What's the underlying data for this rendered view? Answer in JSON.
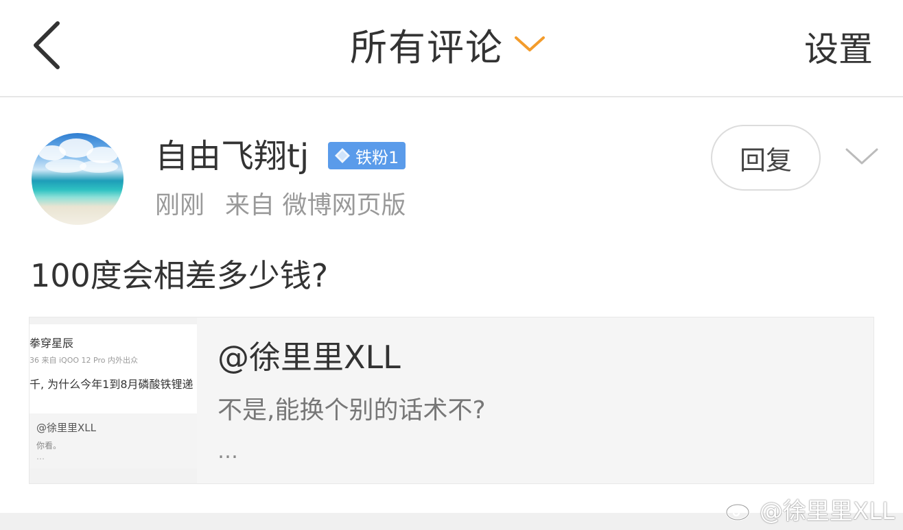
{
  "header": {
    "title": "所有评论",
    "settings_label": "设置"
  },
  "comment": {
    "username": "自由飞翔tj",
    "badge": "铁粉1",
    "time": "刚刚",
    "source": "来自 微博网页版",
    "reply_label": "回复",
    "text": "100度会相差多少钱?"
  },
  "quote": {
    "author": "@徐里里XLL",
    "text": "不是,能换个别的话术不?",
    "ellipsis": "…",
    "thumbnail": {
      "line1": "拳穿星辰",
      "line2": "36 来自 iQOO 12 Pro 内外出众",
      "line3": "千, 为什么今年1到8月磷酸铁锂递",
      "line4": "@徐里里XLL",
      "line5": "你看。",
      "line6": "…"
    }
  },
  "watermark": "@徐里里XLL",
  "colors": {
    "accent_orange": "#f39c2c",
    "badge_blue": "#5a9bea",
    "secondary_text": "#999999"
  }
}
